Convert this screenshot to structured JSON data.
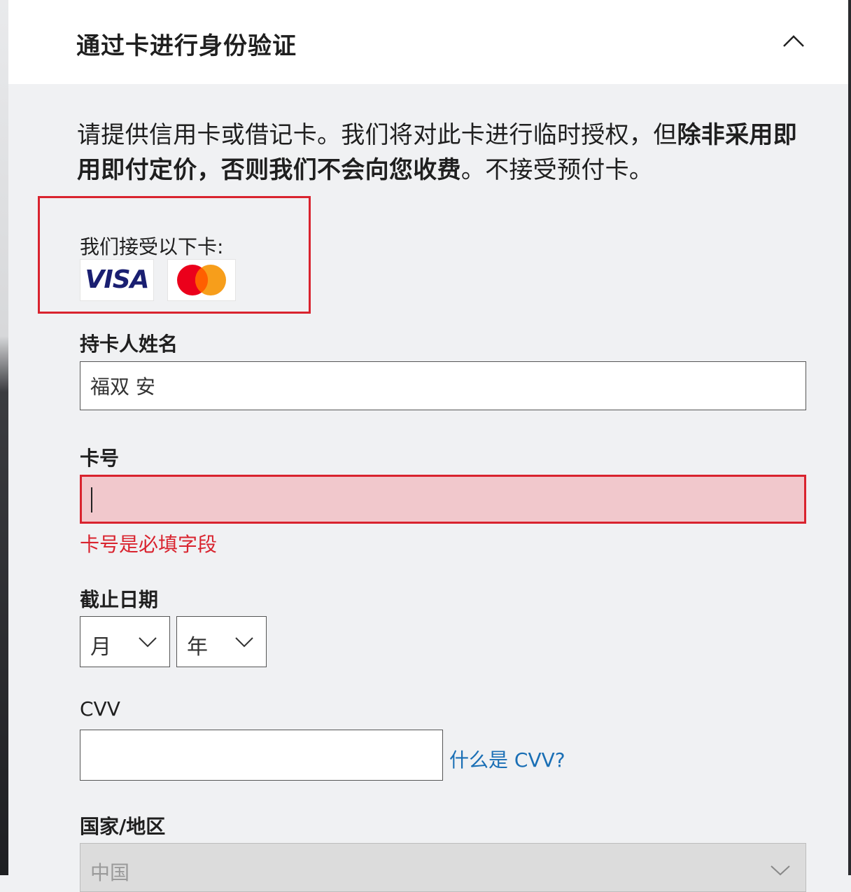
{
  "header": {
    "title": "通过卡进行身份验证"
  },
  "intro": {
    "normal1": "请提供信用卡或借记卡。我们将对此卡进行临时授权，但",
    "bold": "除非采用即用即付定价，否则我们不会向您收费",
    "normal2": "。不接受预付卡。"
  },
  "accepted_cards": {
    "label": "我们接受以下卡:",
    "cards": [
      {
        "name": "VISA",
        "icon": "visa-logo",
        "color": "#1a1f71"
      },
      {
        "name": "Mastercard",
        "icon": "mastercard-logo",
        "colors": [
          "#eb001b",
          "#f79e1b"
        ]
      }
    ],
    "highlight_color": "#d9232e"
  },
  "form": {
    "cardholder": {
      "label": "持卡人姓名",
      "value": "福双 安"
    },
    "card_number": {
      "label": "卡号",
      "value": "",
      "error": "卡号是必填字段",
      "error_color": "#d9232e"
    },
    "expiry": {
      "label": "截止日期",
      "month": "月",
      "year": "年"
    },
    "cvv": {
      "label": "CVV",
      "value": "",
      "help_link": "什么是 CVV?"
    },
    "country": {
      "label": "国家/地区",
      "value": "中国"
    }
  }
}
